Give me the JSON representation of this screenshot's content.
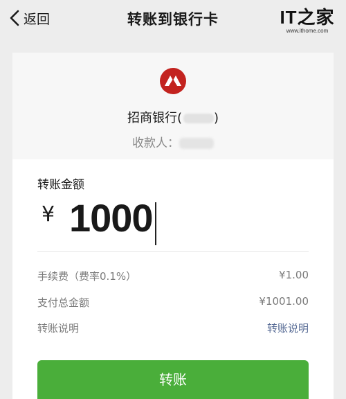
{
  "header": {
    "back_label": "返回",
    "title": "转账到银行卡"
  },
  "watermark": {
    "logo_text": "IT之家",
    "url": "www.ithome.com"
  },
  "bank": {
    "name": "招商银行(",
    "name_suffix": ")",
    "payee_label": "收款人："
  },
  "transfer": {
    "amount_label": "转账金额",
    "currency": "¥",
    "amount": "1000"
  },
  "details": [
    {
      "label": "手续费（费率0.1%）",
      "value": "¥1.00"
    },
    {
      "label": "支付总金额",
      "value": "¥1001.00"
    },
    {
      "label": "转账说明",
      "value": "转账说明"
    }
  ],
  "submit_label": "转账",
  "colors": {
    "primary_button": "#4aae3a",
    "link": "#576b95",
    "bank_logo_red": "#c3231f"
  }
}
